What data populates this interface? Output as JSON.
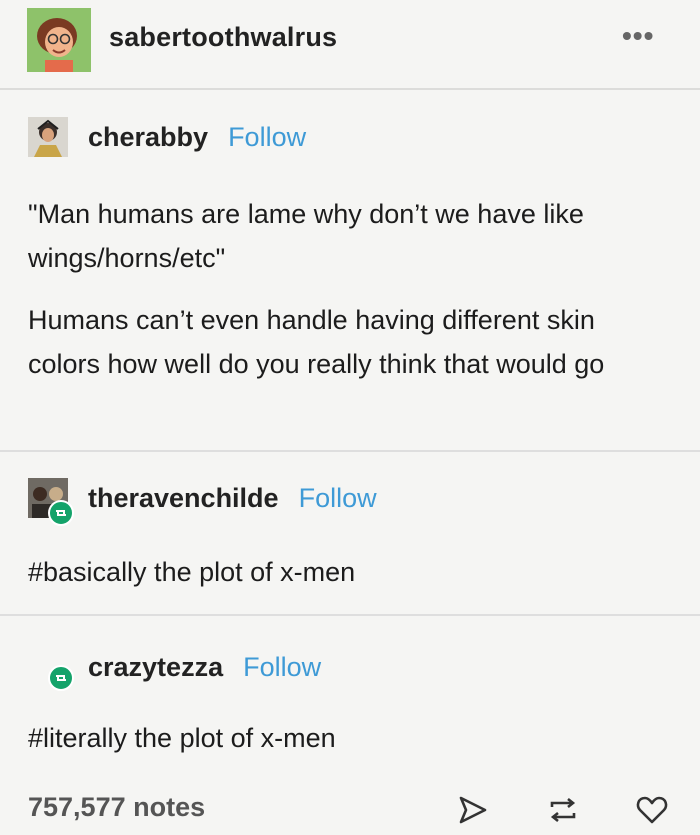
{
  "header": {
    "blogname": "sabertoothwalrus",
    "more": "•••"
  },
  "posts": [
    {
      "user": "cherabby",
      "follow": "Follow",
      "paragraphs": [
        "\"Man humans are lame why don’t we have like wings/horns/etc\"",
        "Humans can’t even handle having different skin colors how well do you really think that would go"
      ]
    },
    {
      "user": "theravenchilde",
      "follow": "Follow",
      "paragraphs": [
        "#basically the plot of x-men"
      ]
    },
    {
      "user": "crazytezza",
      "follow": "Follow",
      "paragraphs": [
        "#literally the plot of x-men"
      ]
    }
  ],
  "footer": {
    "notes": "757,577 notes"
  },
  "colors": {
    "follow": "#3e9ad6",
    "reblog_badge": "#14a36a",
    "avatar_bg": "#8ec26a"
  },
  "icons": [
    "share-icon",
    "reblog-icon",
    "heart-icon",
    "more-icon"
  ]
}
